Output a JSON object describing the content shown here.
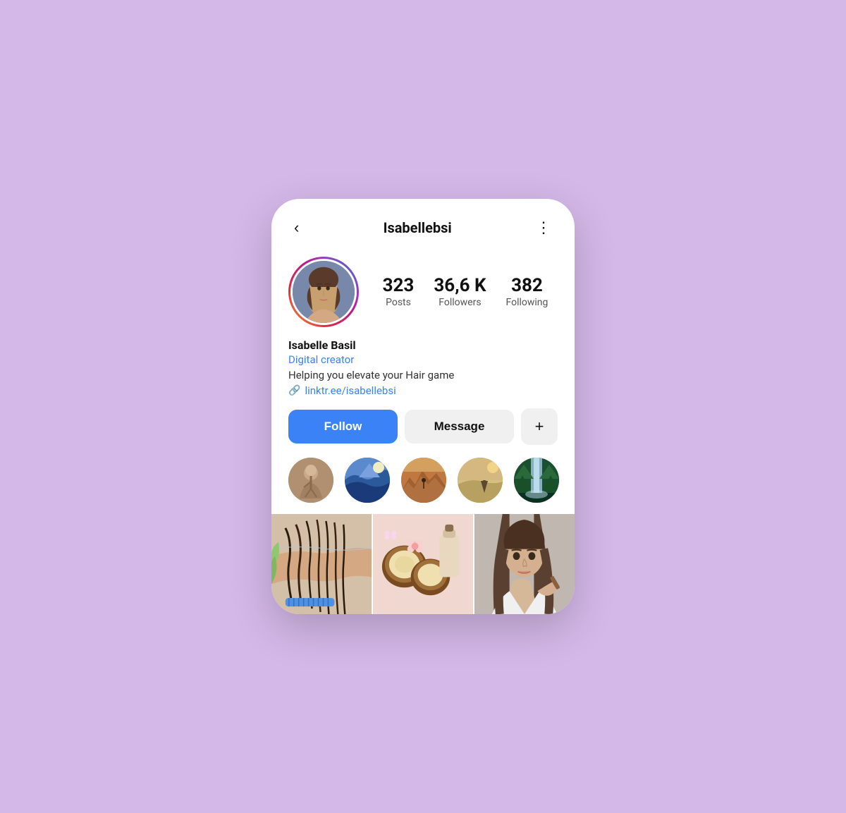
{
  "header": {
    "back_label": "‹",
    "title": "Isabellebsi",
    "more_label": "⋮"
  },
  "profile": {
    "display_name": "Isabelle Basil",
    "category": "Digital creator",
    "bio": "Helping you elevate your Hair game",
    "link_icon": "🔗",
    "link_text": "linktr.ee/isabellebsi",
    "stats": {
      "posts_count": "323",
      "posts_label": "Posts",
      "followers_count": "36,6 K",
      "followers_label": "Followers",
      "following_count": "382",
      "following_label": "Following"
    }
  },
  "buttons": {
    "follow_label": "Follow",
    "message_label": "Message",
    "plus_label": "+"
  },
  "highlights": [
    {
      "id": 1,
      "color_class": "hl-1"
    },
    {
      "id": 2,
      "color_class": "hl-2"
    },
    {
      "id": 3,
      "color_class": "hl-3"
    },
    {
      "id": 4,
      "color_class": "hl-4"
    },
    {
      "id": 5,
      "color_class": "hl-5"
    }
  ],
  "posts": [
    {
      "id": 1,
      "color_class": "post-1",
      "description": "hair washing"
    },
    {
      "id": 2,
      "color_class": "post-2",
      "description": "coconut products"
    },
    {
      "id": 3,
      "color_class": "post-3",
      "description": "hair portrait"
    }
  ]
}
